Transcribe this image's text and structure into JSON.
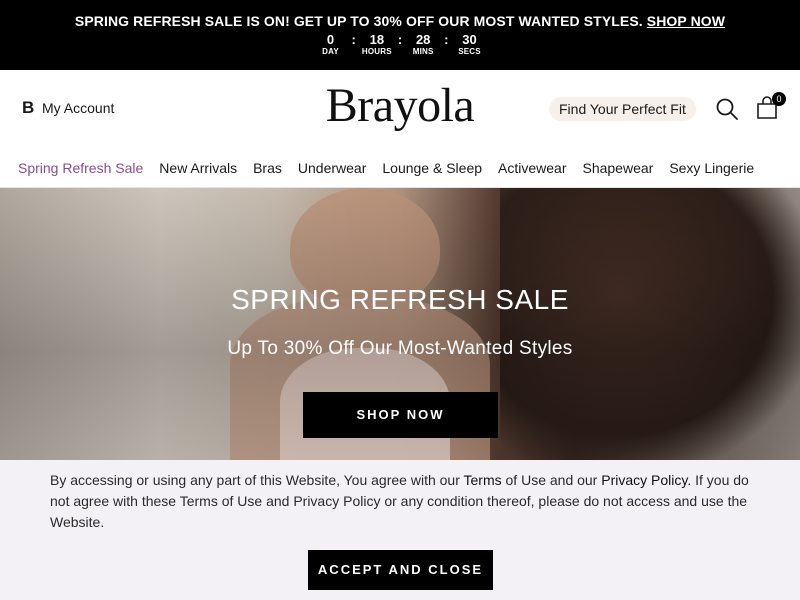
{
  "promo": {
    "text": "SPRING REFRESH SALE IS ON! GET UP TO 30% OFF OUR MOST WANTED STYLES.",
    "link": "SHOP NOW",
    "countdown": [
      {
        "value": "0",
        "label": "DAY"
      },
      {
        "value": "18",
        "label": "HOURS"
      },
      {
        "value": "28",
        "label": "MINS"
      },
      {
        "value": "30",
        "label": "SECS"
      }
    ],
    "separator": ":"
  },
  "header": {
    "account_icon": "B",
    "account_label": "My Account",
    "logo": "Brayola",
    "fit_button": "Find Your Perfect Fit",
    "cart_count": "0"
  },
  "nav": {
    "items": [
      "Spring Refresh Sale",
      "New Arrivals",
      "Bras",
      "Underwear",
      "Lounge & Sleep",
      "Activewear",
      "Shapewear",
      "Sexy Lingerie"
    ]
  },
  "hero": {
    "title": "SPRING REFRESH SALE",
    "subtitle": "Up To 30% Off Our Most-Wanted Styles",
    "button": "SHOP NOW"
  },
  "consent": {
    "part1": "By accessing or using any part of this Website, You agree with our ",
    "terms_link": "Terms",
    "part2": " of Use and our ",
    "privacy_link": "Privacy Policy",
    "part3": ". If you do not agree with these Terms of Use and Privacy Policy or any condition thereof, please do not access and use the Website.",
    "button": "ACCEPT AND CLOSE"
  },
  "colors": {
    "sale_accent": "#8a4c8e",
    "fit_button_bg": "#f6efea",
    "consent_bg": "#f3f1f5"
  }
}
